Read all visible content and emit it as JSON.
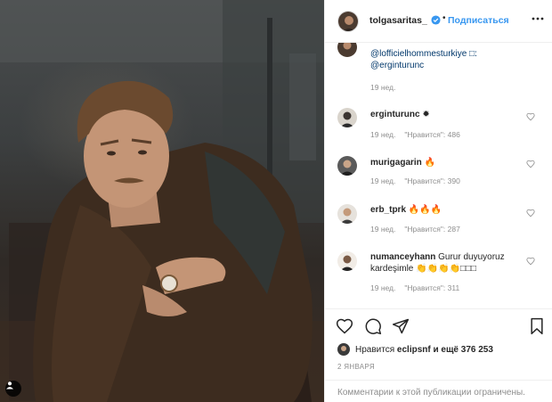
{
  "header": {
    "username": "tolgasaritas_",
    "separator": "•",
    "follow_label": "Подписаться"
  },
  "comments": [
    {
      "text_lines": [
        "@lofficielhommesturkiye □:",
        "@erginturunc"
      ],
      "time": "19 нед."
    },
    {
      "user": "erginturunc",
      "text": "✹",
      "time": "19 нед.",
      "likes": "\"Нравится\": 486"
    },
    {
      "user": "murigagarin",
      "text": "🔥",
      "time": "19 нед.",
      "likes": "\"Нравится\": 390"
    },
    {
      "user": "erb_tprk",
      "text": "🔥🔥🔥",
      "time": "19 нед.",
      "likes": "\"Нравится\": 287"
    },
    {
      "user": "numanceyhann",
      "text": "Gurur duyuyoruz",
      "text2": "kardeşimle 👏👏👏👏□□□",
      "time": "19 нед.",
      "likes": "\"Нравится\": 311"
    }
  ],
  "actions": {
    "likes_prefix": "Нравится",
    "likes_user": "eclipsnf",
    "likes_suffix": "и ещё 376 253",
    "date": "2 ЯНВАРЯ"
  },
  "footer": {
    "comments_closed": "Комментарии к этой публикации ограничены."
  },
  "colors": {
    "accent": "#3897f0",
    "verified": "#3897f0",
    "link": "#00376b",
    "muted": "#8e8e8e"
  },
  "icons": [
    "user-tag-icon",
    "verified-badge-icon",
    "more-options-icon",
    "heart-icon",
    "comment-icon",
    "share-icon",
    "bookmark-icon"
  ]
}
